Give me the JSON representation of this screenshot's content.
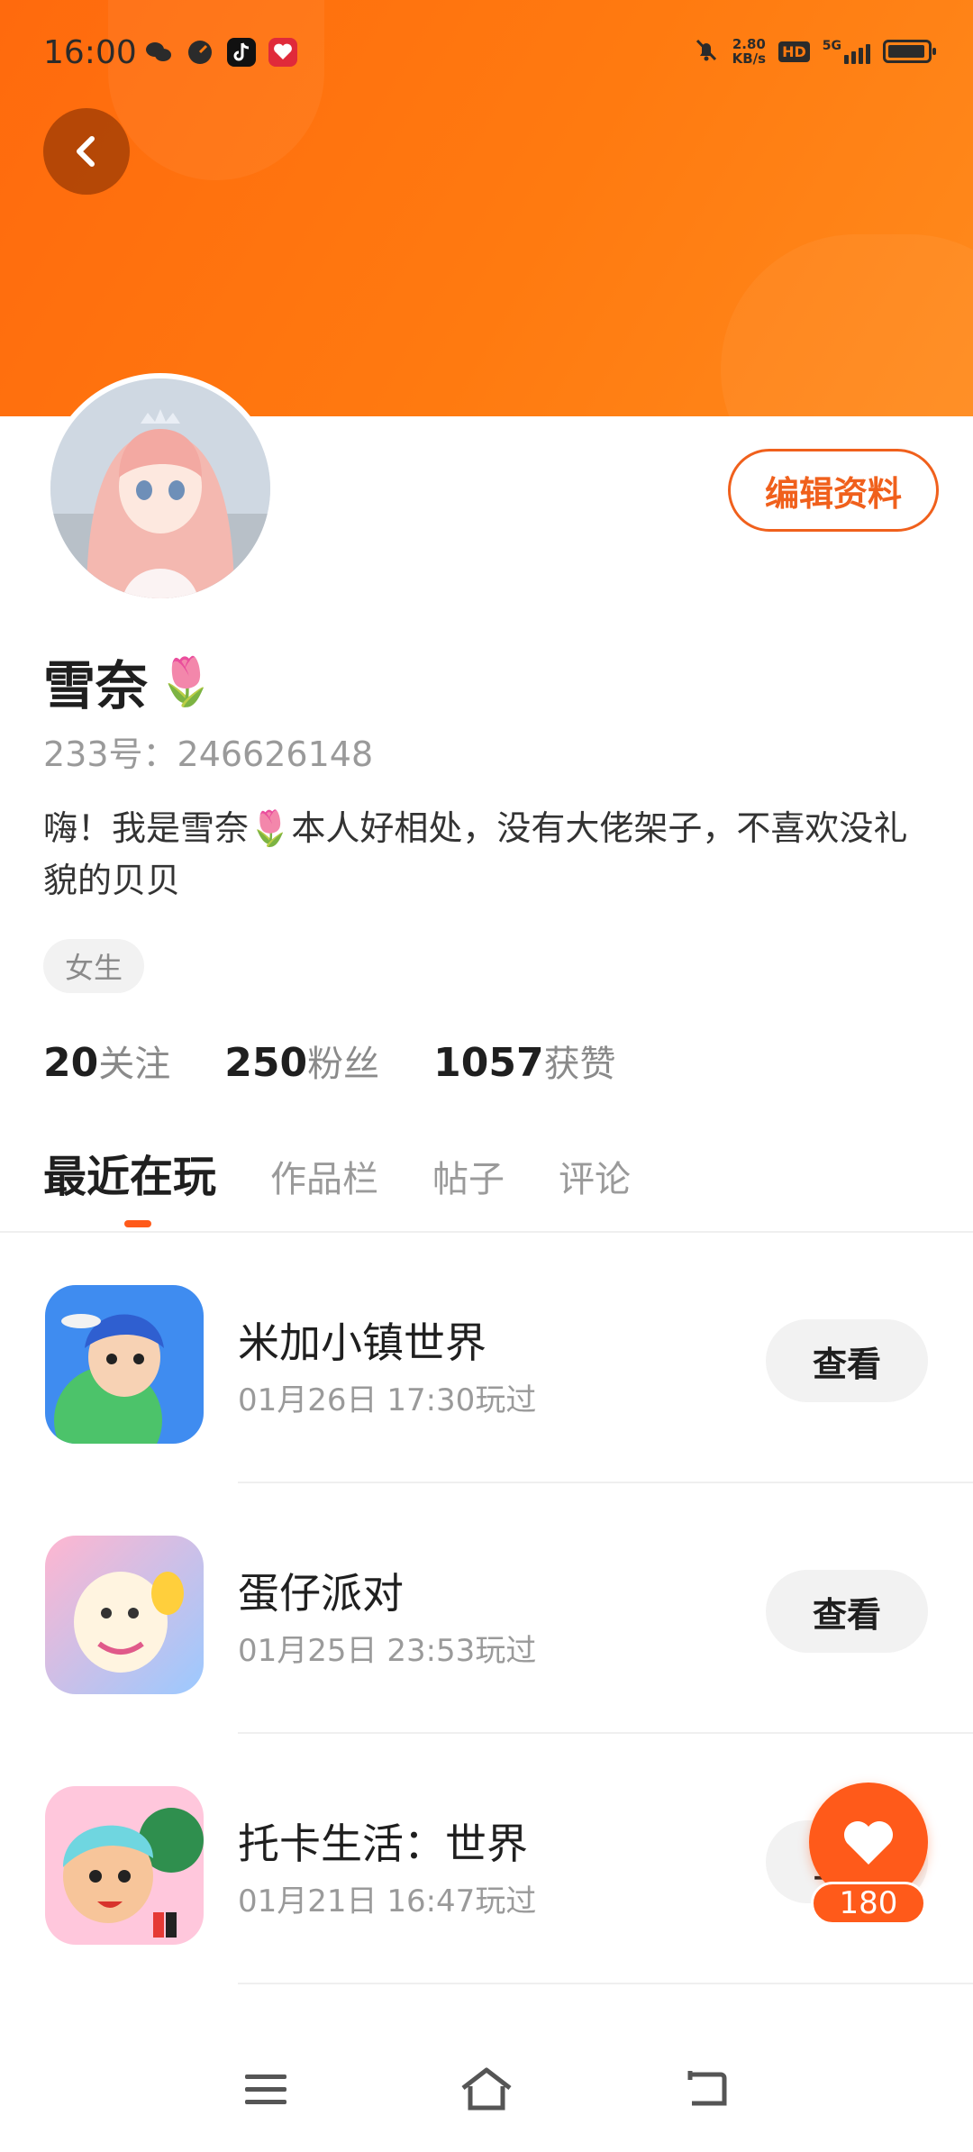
{
  "status_bar": {
    "time": "16:00",
    "net_speed_value": "2.80",
    "net_speed_unit": "KB/s",
    "hd": "HD",
    "network": "5G"
  },
  "profile": {
    "name": "雪奈",
    "name_emoji": "🌷",
    "id": "233号：246626148",
    "bio": "嗨！我是雪奈🌷本人好相处，没有大佬架子，不喜欢没礼貌的贝贝",
    "tag": "女生",
    "edit_label": "编辑资料"
  },
  "stats": [
    {
      "num": "20",
      "label": "关注"
    },
    {
      "num": "250",
      "label": "粉丝"
    },
    {
      "num": "1057",
      "label": "获赞"
    }
  ],
  "tabs": [
    "最近在玩",
    "作品栏",
    "帖子",
    "评论"
  ],
  "games": [
    {
      "title": "米加小镇世界",
      "time": "01月26日 17:30玩过",
      "button": "查看"
    },
    {
      "title": "蛋仔派对",
      "time": "01月25日 23:53玩过",
      "button": "查看"
    },
    {
      "title": "托卡生活：世界",
      "time": "01月21日 16:47玩过",
      "button": "查看"
    }
  ],
  "like": {
    "count": "180"
  },
  "colors": {
    "accent": "#ff5a1a",
    "header": "#ff7a10"
  }
}
